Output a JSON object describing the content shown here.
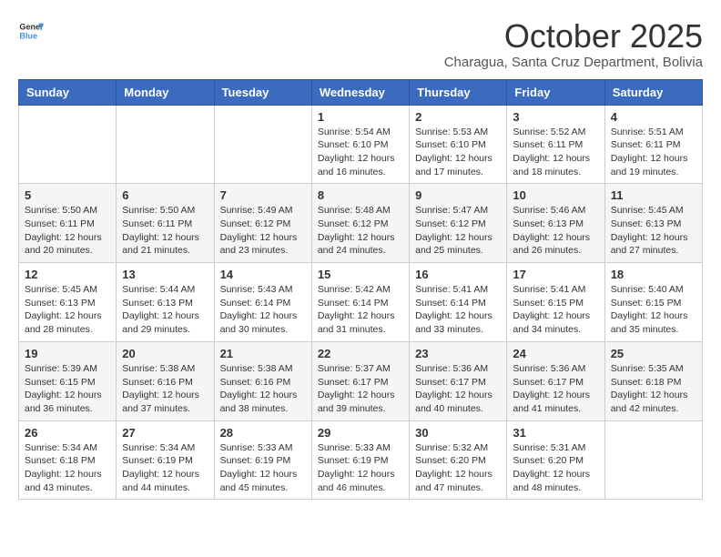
{
  "header": {
    "logo_general": "General",
    "logo_blue": "Blue",
    "month_title": "October 2025",
    "subtitle": "Charagua, Santa Cruz Department, Bolivia"
  },
  "weekdays": [
    "Sunday",
    "Monday",
    "Tuesday",
    "Wednesday",
    "Thursday",
    "Friday",
    "Saturday"
  ],
  "weeks": [
    [
      {
        "day": "",
        "detail": ""
      },
      {
        "day": "",
        "detail": ""
      },
      {
        "day": "",
        "detail": ""
      },
      {
        "day": "1",
        "detail": "Sunrise: 5:54 AM\nSunset: 6:10 PM\nDaylight: 12 hours\nand 16 minutes."
      },
      {
        "day": "2",
        "detail": "Sunrise: 5:53 AM\nSunset: 6:10 PM\nDaylight: 12 hours\nand 17 minutes."
      },
      {
        "day": "3",
        "detail": "Sunrise: 5:52 AM\nSunset: 6:11 PM\nDaylight: 12 hours\nand 18 minutes."
      },
      {
        "day": "4",
        "detail": "Sunrise: 5:51 AM\nSunset: 6:11 PM\nDaylight: 12 hours\nand 19 minutes."
      }
    ],
    [
      {
        "day": "5",
        "detail": "Sunrise: 5:50 AM\nSunset: 6:11 PM\nDaylight: 12 hours\nand 20 minutes."
      },
      {
        "day": "6",
        "detail": "Sunrise: 5:50 AM\nSunset: 6:11 PM\nDaylight: 12 hours\nand 21 minutes."
      },
      {
        "day": "7",
        "detail": "Sunrise: 5:49 AM\nSunset: 6:12 PM\nDaylight: 12 hours\nand 23 minutes."
      },
      {
        "day": "8",
        "detail": "Sunrise: 5:48 AM\nSunset: 6:12 PM\nDaylight: 12 hours\nand 24 minutes."
      },
      {
        "day": "9",
        "detail": "Sunrise: 5:47 AM\nSunset: 6:12 PM\nDaylight: 12 hours\nand 25 minutes."
      },
      {
        "day": "10",
        "detail": "Sunrise: 5:46 AM\nSunset: 6:13 PM\nDaylight: 12 hours\nand 26 minutes."
      },
      {
        "day": "11",
        "detail": "Sunrise: 5:45 AM\nSunset: 6:13 PM\nDaylight: 12 hours\nand 27 minutes."
      }
    ],
    [
      {
        "day": "12",
        "detail": "Sunrise: 5:45 AM\nSunset: 6:13 PM\nDaylight: 12 hours\nand 28 minutes."
      },
      {
        "day": "13",
        "detail": "Sunrise: 5:44 AM\nSunset: 6:13 PM\nDaylight: 12 hours\nand 29 minutes."
      },
      {
        "day": "14",
        "detail": "Sunrise: 5:43 AM\nSunset: 6:14 PM\nDaylight: 12 hours\nand 30 minutes."
      },
      {
        "day": "15",
        "detail": "Sunrise: 5:42 AM\nSunset: 6:14 PM\nDaylight: 12 hours\nand 31 minutes."
      },
      {
        "day": "16",
        "detail": "Sunrise: 5:41 AM\nSunset: 6:14 PM\nDaylight: 12 hours\nand 33 minutes."
      },
      {
        "day": "17",
        "detail": "Sunrise: 5:41 AM\nSunset: 6:15 PM\nDaylight: 12 hours\nand 34 minutes."
      },
      {
        "day": "18",
        "detail": "Sunrise: 5:40 AM\nSunset: 6:15 PM\nDaylight: 12 hours\nand 35 minutes."
      }
    ],
    [
      {
        "day": "19",
        "detail": "Sunrise: 5:39 AM\nSunset: 6:15 PM\nDaylight: 12 hours\nand 36 minutes."
      },
      {
        "day": "20",
        "detail": "Sunrise: 5:38 AM\nSunset: 6:16 PM\nDaylight: 12 hours\nand 37 minutes."
      },
      {
        "day": "21",
        "detail": "Sunrise: 5:38 AM\nSunset: 6:16 PM\nDaylight: 12 hours\nand 38 minutes."
      },
      {
        "day": "22",
        "detail": "Sunrise: 5:37 AM\nSunset: 6:17 PM\nDaylight: 12 hours\nand 39 minutes."
      },
      {
        "day": "23",
        "detail": "Sunrise: 5:36 AM\nSunset: 6:17 PM\nDaylight: 12 hours\nand 40 minutes."
      },
      {
        "day": "24",
        "detail": "Sunrise: 5:36 AM\nSunset: 6:17 PM\nDaylight: 12 hours\nand 41 minutes."
      },
      {
        "day": "25",
        "detail": "Sunrise: 5:35 AM\nSunset: 6:18 PM\nDaylight: 12 hours\nand 42 minutes."
      }
    ],
    [
      {
        "day": "26",
        "detail": "Sunrise: 5:34 AM\nSunset: 6:18 PM\nDaylight: 12 hours\nand 43 minutes."
      },
      {
        "day": "27",
        "detail": "Sunrise: 5:34 AM\nSunset: 6:19 PM\nDaylight: 12 hours\nand 44 minutes."
      },
      {
        "day": "28",
        "detail": "Sunrise: 5:33 AM\nSunset: 6:19 PM\nDaylight: 12 hours\nand 45 minutes."
      },
      {
        "day": "29",
        "detail": "Sunrise: 5:33 AM\nSunset: 6:19 PM\nDaylight: 12 hours\nand 46 minutes."
      },
      {
        "day": "30",
        "detail": "Sunrise: 5:32 AM\nSunset: 6:20 PM\nDaylight: 12 hours\nand 47 minutes."
      },
      {
        "day": "31",
        "detail": "Sunrise: 5:31 AM\nSunset: 6:20 PM\nDaylight: 12 hours\nand 48 minutes."
      },
      {
        "day": "",
        "detail": ""
      }
    ]
  ]
}
